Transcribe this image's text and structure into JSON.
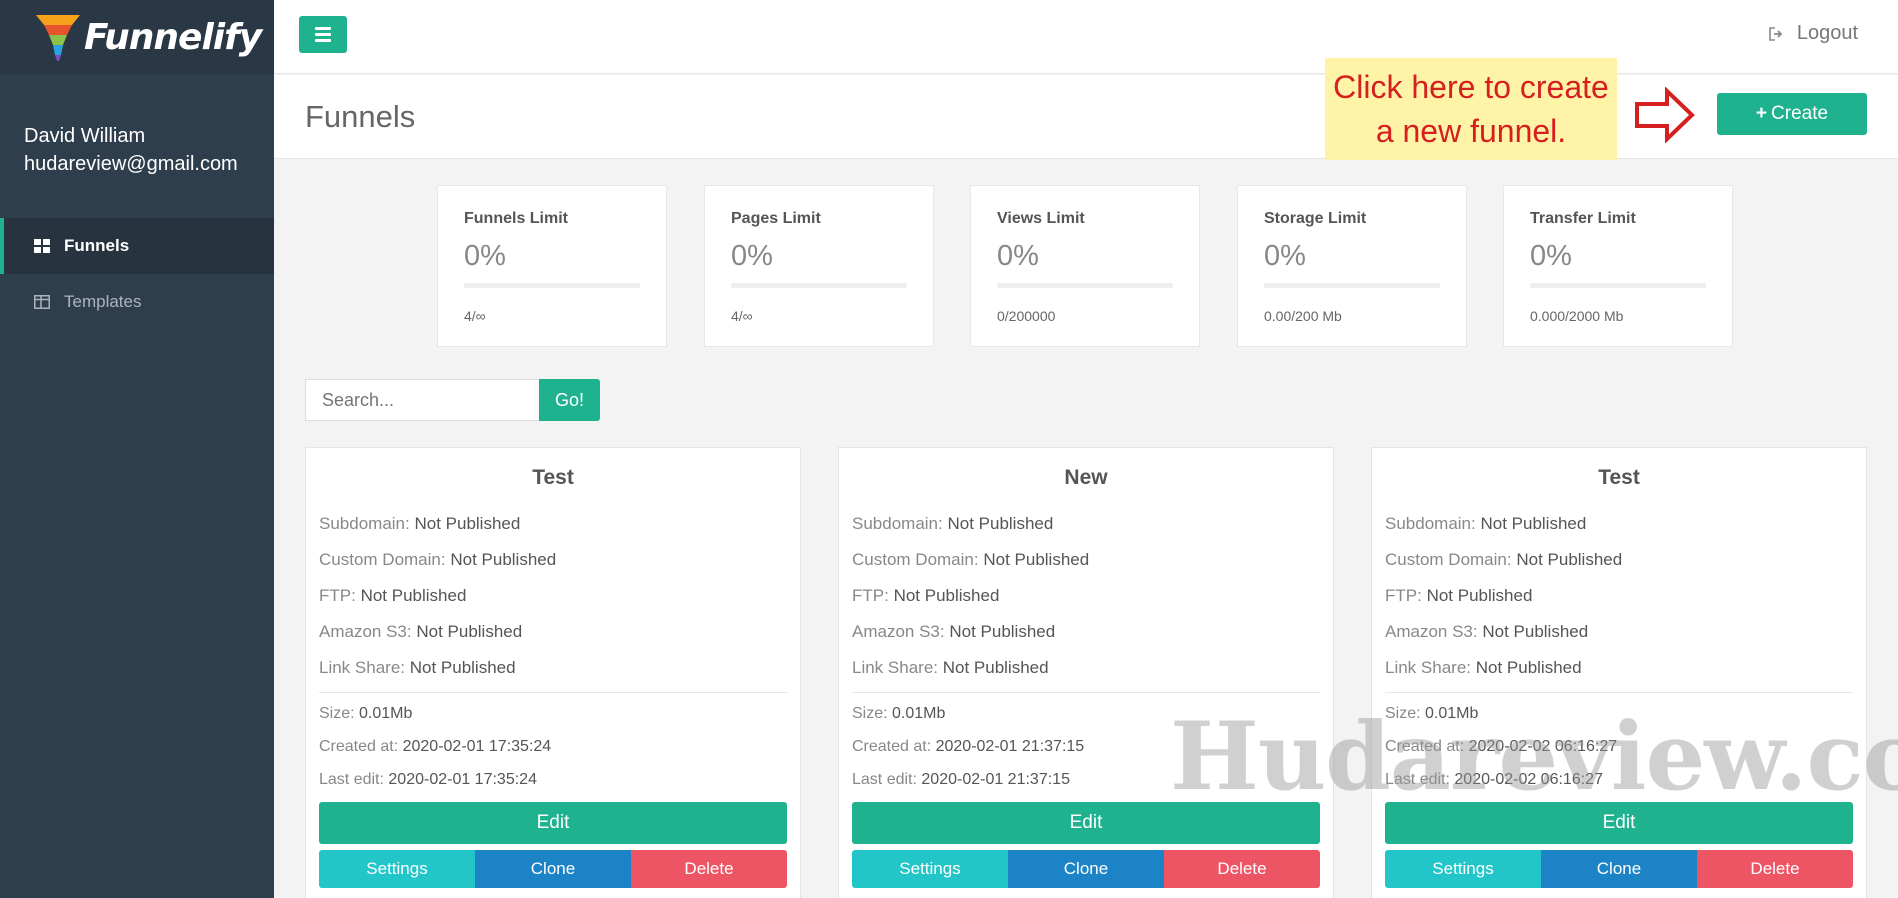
{
  "brand": {
    "name": "Funnelify"
  },
  "user": {
    "name": "David William",
    "email": "hudareview@gmail.com"
  },
  "sidebar": {
    "items": [
      {
        "label": "Funnels",
        "icon": "grid-icon",
        "active": true
      },
      {
        "label": "Templates",
        "icon": "columns-icon",
        "active": false
      }
    ]
  },
  "topbar": {
    "logout_label": "Logout"
  },
  "page": {
    "title": "Funnels",
    "create_label": "Create"
  },
  "callout": {
    "line1": "Click here to create",
    "line2": "a new funnel."
  },
  "stats": [
    {
      "label": "Funnels Limit",
      "percent": "0%",
      "sub": "4/∞"
    },
    {
      "label": "Pages Limit",
      "percent": "0%",
      "sub": "4/∞"
    },
    {
      "label": "Views Limit",
      "percent": "0%",
      "sub": "0/200000"
    },
    {
      "label": "Storage Limit",
      "percent": "0%",
      "sub": "0.00/200 Mb"
    },
    {
      "label": "Transfer Limit",
      "percent": "0%",
      "sub": "0.000/2000 Mb"
    }
  ],
  "search": {
    "placeholder": "Search...",
    "go_label": "Go!"
  },
  "labels": {
    "subdomain": "Subdomain:",
    "custom_domain": "Custom Domain:",
    "ftp": "FTP:",
    "amazon": "Amazon S3:",
    "link_share": "Link Share:",
    "size": "Size:",
    "created": "Created at:",
    "last_edit": "Last edit:",
    "edit": "Edit",
    "settings": "Settings",
    "clone": "Clone",
    "delete": "Delete"
  },
  "funnels": [
    {
      "title": "Test",
      "subdomain": "Not Published",
      "custom_domain": "Not Published",
      "ftp": "Not Published",
      "amazon": "Not Published",
      "link_share": "Not Published",
      "size": "0.01Mb",
      "created": "2020-02-01 17:35:24",
      "last_edit": "2020-02-01 17:35:24"
    },
    {
      "title": "New",
      "subdomain": "Not Published",
      "custom_domain": "Not Published",
      "ftp": "Not Published",
      "amazon": "Not Published",
      "link_share": "Not Published",
      "size": "0.01Mb",
      "created": "2020-02-01 21:37:15",
      "last_edit": "2020-02-01 21:37:15"
    },
    {
      "title": "Test",
      "subdomain": "Not Published",
      "custom_domain": "Not Published",
      "ftp": "Not Published",
      "amazon": "Not Published",
      "link_share": "Not Published",
      "size": "0.01Mb",
      "created": "2020-02-02 06:16:27",
      "last_edit": "2020-02-02 06:16:27"
    }
  ],
  "watermark": "Hudareview.com",
  "colors": {
    "accent": "#1fb28f",
    "sidebar": "#2f3e4c",
    "settings": "#23c6c8",
    "clone": "#1c84c6",
    "delete": "#ed5565",
    "callout_bg": "#fff3a8",
    "callout_text": "#d62020"
  }
}
